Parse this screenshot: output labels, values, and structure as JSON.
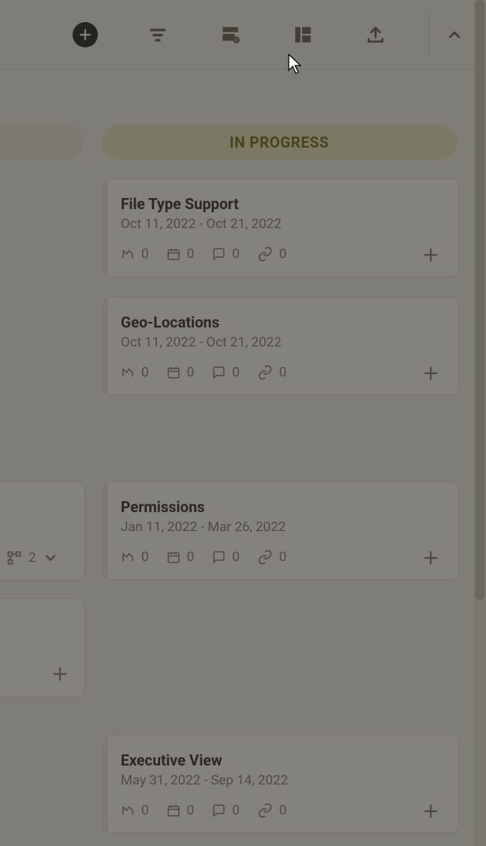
{
  "toolbar": {
    "add_label": "Add",
    "filter_label": "Filter",
    "columns_label": "Edit columns",
    "layout_label": "Layout",
    "export_label": "Export",
    "collapse_label": "Collapse"
  },
  "columns": {
    "left_partial_label": "",
    "in_progress_label": "IN PROGRESS"
  },
  "cards": [
    {
      "title": "File Type Support",
      "dates": "Oct 11, 2022 - Oct 21, 2022",
      "meta": {
        "progress": "0",
        "date": "0",
        "comments": "0",
        "attachments": "0"
      }
    },
    {
      "title": "Geo-Locations",
      "dates": "Oct 11, 2022 - Oct 21, 2022",
      "meta": {
        "progress": "0",
        "date": "0",
        "comments": "0",
        "attachments": "0"
      }
    },
    {
      "title": "Permissions",
      "dates": "Jan 11, 2022 - Mar 26, 2022",
      "meta": {
        "progress": "0",
        "date": "0",
        "comments": "0",
        "attachments": "0"
      }
    },
    {
      "title": "Executive View",
      "dates": "May 31, 2022 - Sep 14, 2022",
      "meta": {
        "progress": "0",
        "date": "0",
        "comments": "0",
        "attachments": "0"
      }
    }
  ],
  "stubs": {
    "a": {
      "count": "2"
    }
  }
}
